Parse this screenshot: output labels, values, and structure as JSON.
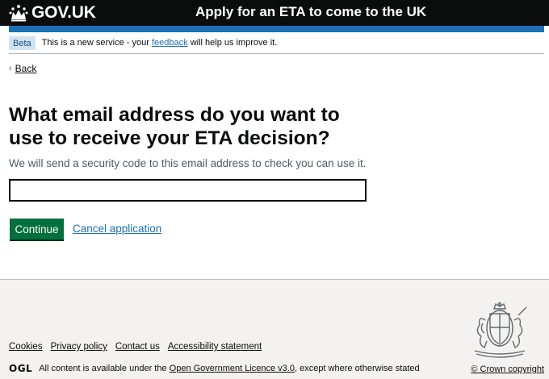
{
  "header": {
    "logo_text": "GOV.UK",
    "service_name": "Apply for an ETA to come to the UK"
  },
  "phase_banner": {
    "tag": "Beta",
    "text_before": "This is a new service - your",
    "link_text": "feedback",
    "text_after": "will help us improve it."
  },
  "back_link": {
    "label": "Back"
  },
  "main": {
    "heading": "What email address do you want to use to receive your ETA decision?",
    "hint": "We will send a security code to this email address to check you can use it.",
    "email_value": "",
    "continue_label": "Continue",
    "cancel_label": "Cancel application"
  },
  "footer": {
    "links": [
      "Cookies",
      "Privacy policy",
      "Contact us",
      "Accessibility statement"
    ],
    "ogl_logo": "OGL",
    "licence_before": "All content is available under the",
    "licence_link": "Open Government Licence v3.0",
    "licence_after": ", except where otherwise stated",
    "copyright": "© Crown copyright"
  },
  "colors": {
    "header_bg": "#0b0c0c",
    "accent_blue": "#1d70b8",
    "button_green": "#00703c",
    "footer_bg": "#f3f2f1"
  },
  "icons": [
    "crown-icon",
    "chevron-left-icon",
    "royal-coat-of-arms-icon"
  ]
}
